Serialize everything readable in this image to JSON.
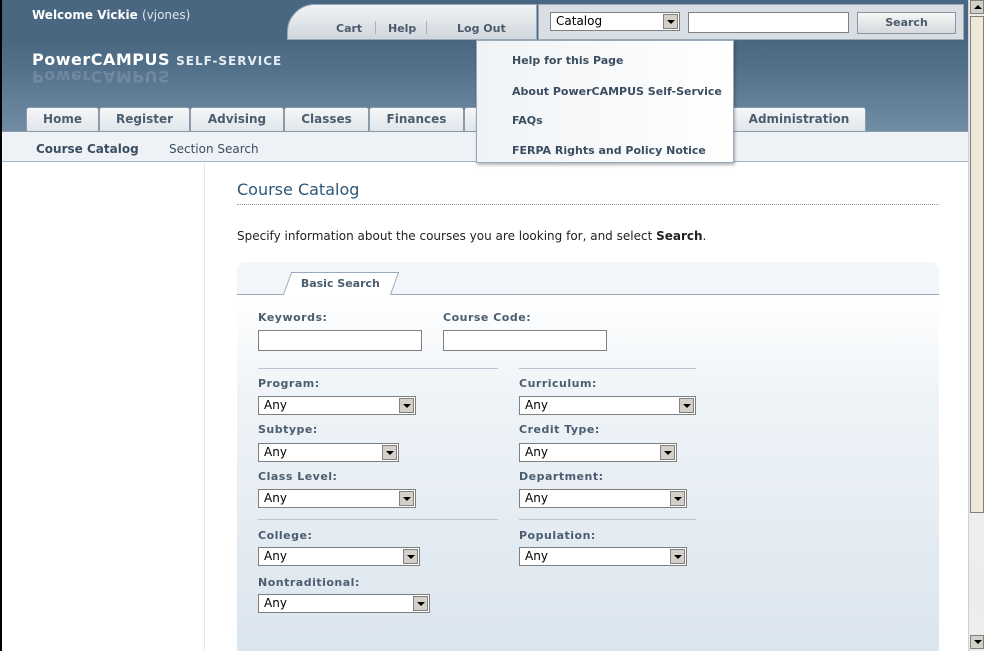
{
  "header": {
    "welcome_label": "Welcome Vickie",
    "username": "(vjones)",
    "brand_main": "PowerCAMPUS",
    "brand_sub": "SELF-SERVICE",
    "tools": {
      "cart": "Cart",
      "help": "Help",
      "logout": "Log Out"
    },
    "search": {
      "scope_selected": "Catalog",
      "query_value": "",
      "button_label": "Search"
    }
  },
  "help_menu": {
    "items": [
      "Help for this Page",
      "About PowerCAMPUS Self-Service",
      "FAQs",
      "FERPA Rights and Policy Notice"
    ]
  },
  "tabs": [
    "Home",
    "Register",
    "Advising",
    "Classes",
    "Finances",
    "Administration"
  ],
  "subnav": [
    "Course Catalog",
    "Section Search"
  ],
  "main": {
    "title": "Course Catalog",
    "intro_prefix": "Specify information about the courses you are looking for, and select ",
    "intro_bold": "Search",
    "intro_suffix": ".",
    "panel_tab": "Basic Search",
    "fields": {
      "keywords": {
        "label": "Keywords:",
        "value": ""
      },
      "course_code": {
        "label": "Course Code:",
        "value": ""
      },
      "program": {
        "label": "Program:",
        "selected": "Any"
      },
      "curriculum": {
        "label": "Curriculum:",
        "selected": "Any"
      },
      "subtype": {
        "label": "Subtype:",
        "selected": "Any"
      },
      "credit_type": {
        "label": "Credit Type:",
        "selected": "Any"
      },
      "class_level": {
        "label": "Class Level:",
        "selected": "Any"
      },
      "department": {
        "label": "Department:",
        "selected": "Any"
      },
      "college": {
        "label": "College:",
        "selected": "Any"
      },
      "population": {
        "label": "Population:",
        "selected": "Any"
      },
      "nontraditional": {
        "label": "Nontraditional:",
        "selected": "Any"
      }
    }
  },
  "colors": {
    "header_bg": "#4a6782",
    "title_blue": "#2d5777",
    "label_gray": "#4b5d6e"
  }
}
